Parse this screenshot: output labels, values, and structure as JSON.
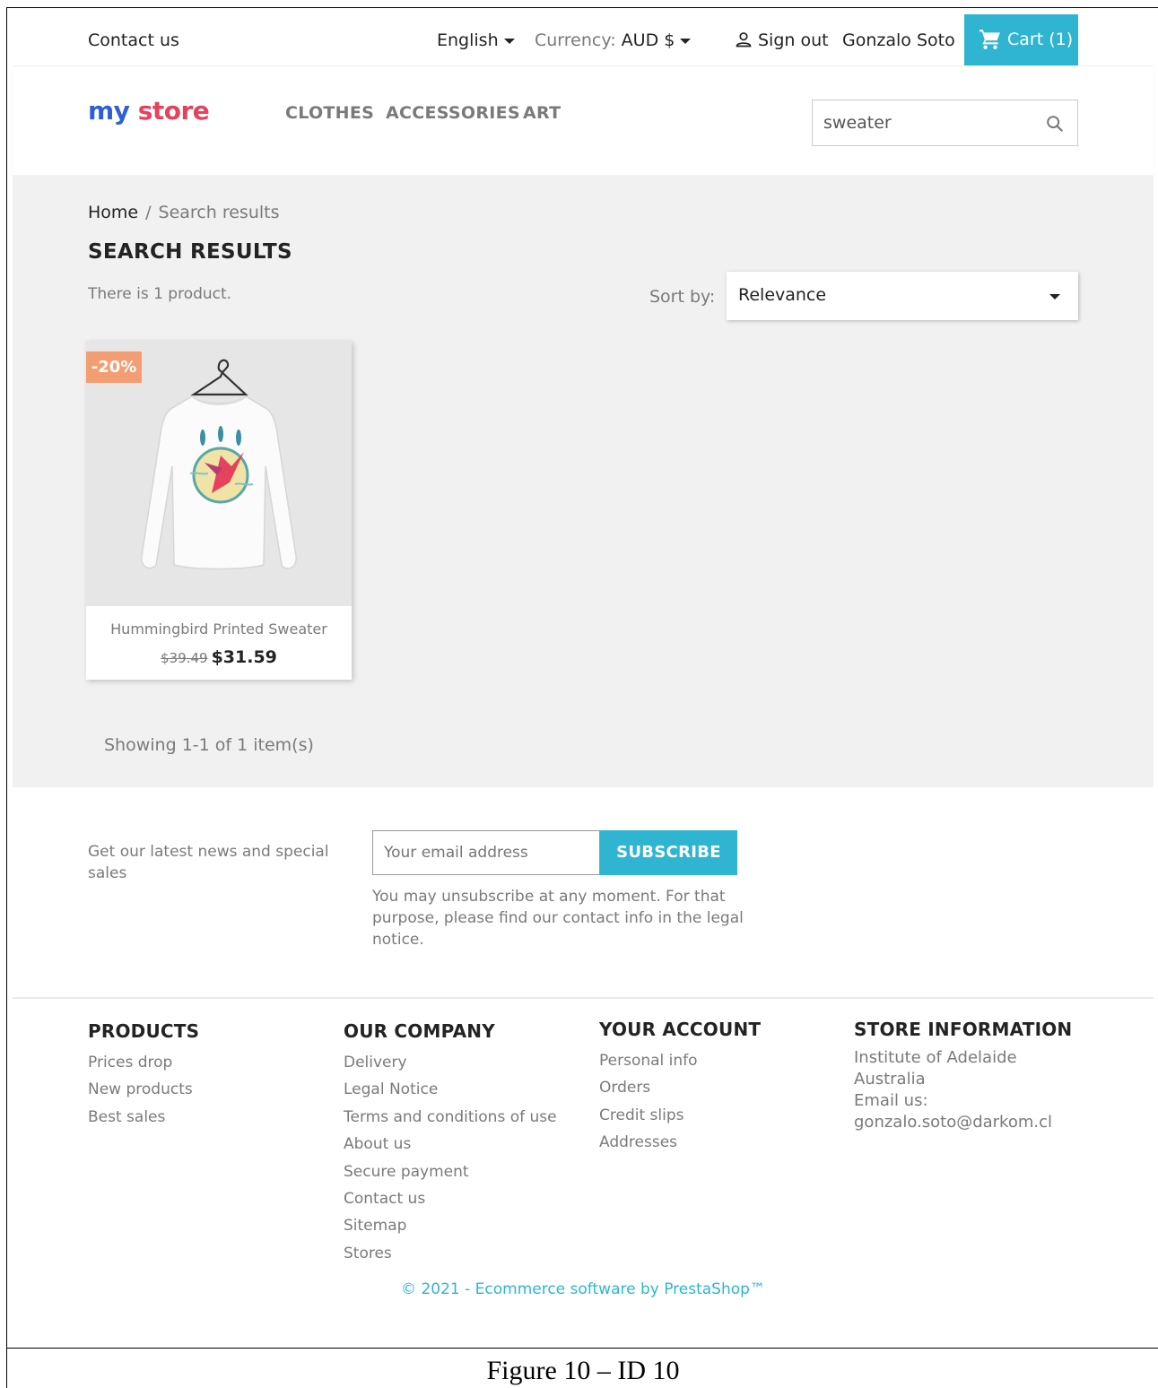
{
  "topnav": {
    "contact": "Contact us",
    "language": "English",
    "currency_label": "Currency:",
    "currency_value": "AUD $",
    "signout": "Sign out",
    "user_name": "Gonzalo Soto",
    "cart": "Cart (1)"
  },
  "logo": {
    "my": "my",
    "store": "store"
  },
  "menu": {
    "clothes": "CLOTHES",
    "accessories": "ACCESSORIES",
    "art": "ART"
  },
  "search": {
    "value": "sweater"
  },
  "breadcrumb": {
    "home": "Home",
    "sep": "/",
    "current": "Search results"
  },
  "page": {
    "title": "SEARCH RESULTS",
    "count_text": "There is 1 product.",
    "sort_label": "Sort by:",
    "sort_value": "Relevance",
    "showing": "Showing 1-1 of 1 item(s)"
  },
  "products": [
    {
      "badge": "-20%",
      "name": "Hummingbird Printed Sweater",
      "old_price": "$39.49",
      "price": "$31.59"
    }
  ],
  "newsletter": {
    "text": "Get our latest news and special sales",
    "placeholder": "Your email address",
    "button": "SUBSCRIBE",
    "note": "You may unsubscribe at any moment. For that purpose, please find our contact info in the legal notice."
  },
  "footer": {
    "products": {
      "title": "PRODUCTS",
      "links": [
        "Prices drop",
        "New products",
        "Best sales"
      ]
    },
    "company": {
      "title": "OUR COMPANY",
      "links": [
        "Delivery",
        "Legal Notice",
        "Terms and conditions of use",
        "About us",
        "Secure payment",
        "Contact us",
        "Sitemap",
        "Stores"
      ]
    },
    "account": {
      "title": "YOUR ACCOUNT",
      "links": [
        "Personal info",
        "Orders",
        "Credit slips",
        "Addresses"
      ]
    },
    "store": {
      "title": "STORE INFORMATION",
      "line1": "Institute of Adelaide",
      "line2": "Australia",
      "email_label": "Email us:",
      "email": "gonzalo.soto@darkom.cl"
    },
    "copyright": "© 2021 - Ecommerce software by PrestaShop™"
  },
  "caption": "Figure 10 – ID  10",
  "colors": {
    "accent": "#2fb5d2",
    "badge": "#f39d72",
    "logo_my": "#2f5fd4",
    "logo_store": "#e4425d"
  }
}
